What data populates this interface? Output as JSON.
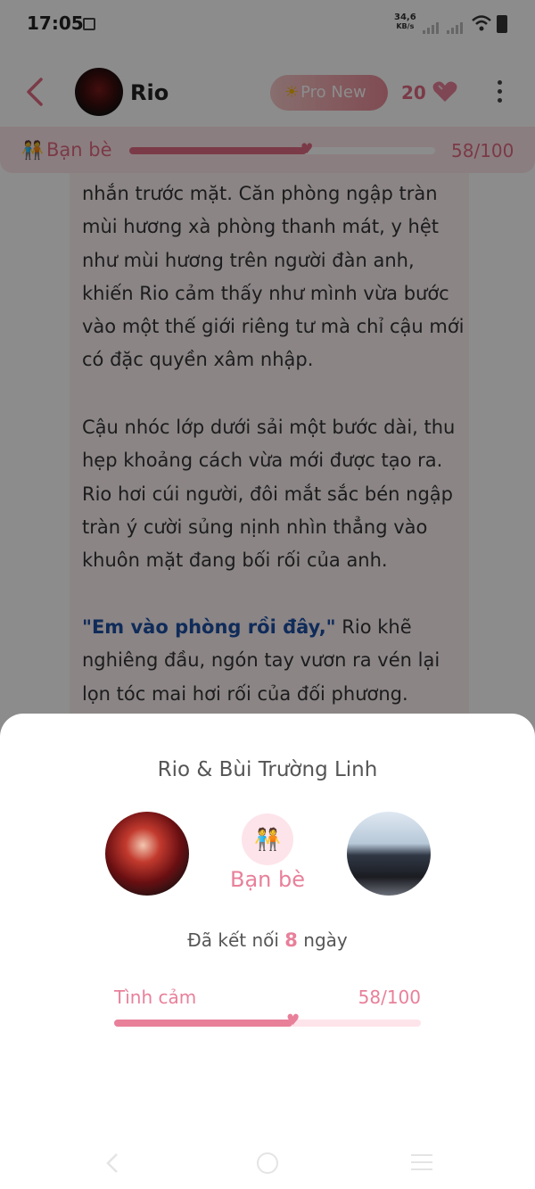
{
  "status_bar": {
    "time": "17:05",
    "net_speed_value": "34,6",
    "net_speed_unit": "KB/s"
  },
  "header": {
    "character_name": "Rio",
    "pro_badge_label": "Pro New",
    "gem_count": "20"
  },
  "relationship_bar": {
    "label": "Bạn bè",
    "score_text": "58/100",
    "progress": 0.58
  },
  "story": {
    "paragraph_1": "nhắn trước mặt. Căn phòng ngập tràn mùi hương xà phòng thanh mát, y hệt như mùi hương trên người đàn anh, khiến Rio cảm thấy như mình vừa bước vào một thế giới riêng tư mà chỉ cậu mới có đặc quyền xâm nhập.",
    "paragraph_2": "Cậu nhóc lớp dưới sải một bước dài, thu hẹp khoảng cách vừa mới được tạo ra. Rio hơi cúi người, đôi mắt sắc bén ngập tràn ý cười sủng nịnh nhìn thẳng vào khuôn mặt đang bối rối của anh.",
    "quote": "\"Em vào phòng rồi đây,\"",
    "paragraph_3_rest": " Rio khẽ nghiêng đầu, ngón tay vươn ra vén lại lọn tóc mai hơi rối của đối phương."
  },
  "sheet": {
    "title": "Rio & Bùi Trường Linh",
    "relationship_label": "Bạn bè",
    "connected_prefix": "Đã kết nối ",
    "connected_days": "8",
    "connected_suffix": " ngày",
    "affection_label": "Tình cảm",
    "affection_score_text": "58/100",
    "affection_progress": 0.58
  },
  "colors": {
    "accent_pink": "#e8809a",
    "quote_blue": "#1d4fa3"
  },
  "icons": {
    "back": "chevron-left",
    "gem": "heart-gem",
    "more": "vertical-dots",
    "relationship": "two-people-holding-hands",
    "pro": "sun"
  }
}
